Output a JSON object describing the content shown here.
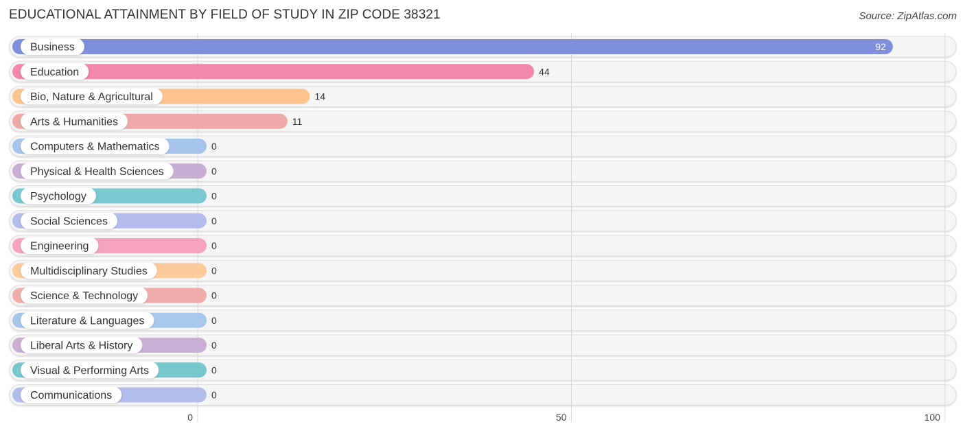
{
  "header": {
    "title": "EDUCATIONAL ATTAINMENT BY FIELD OF STUDY IN ZIP CODE 38321",
    "source": "Source: ZipAtlas.com"
  },
  "chart_data": {
    "type": "bar",
    "orientation": "horizontal",
    "title": "EDUCATIONAL ATTAINMENT BY FIELD OF STUDY IN ZIP CODE 38321",
    "xlabel": "",
    "ylabel": "",
    "xlim": [
      0,
      100
    ],
    "x_ticks": [
      0,
      50,
      100
    ],
    "grid": true,
    "categories": [
      "Business",
      "Education",
      "Bio, Nature & Agricultural",
      "Arts & Humanities",
      "Computers & Mathematics",
      "Physical & Health Sciences",
      "Psychology",
      "Social Sciences",
      "Engineering",
      "Multidisciplinary Studies",
      "Science & Technology",
      "Literature & Languages",
      "Liberal Arts & History",
      "Visual & Performing Arts",
      "Communications"
    ],
    "values": [
      92,
      44,
      14,
      11,
      0,
      0,
      0,
      0,
      0,
      0,
      0,
      0,
      0,
      0,
      0
    ],
    "colors": [
      "#7f8fdc",
      "#f288aa",
      "#fdc48f",
      "#eeaaa7",
      "#a6c5ea",
      "#c9aed3",
      "#77c9cf",
      "#b3bdeb",
      "#f6a3c0",
      "#fdcb9b",
      "#f0aeaa",
      "#a7c7eb",
      "#caaed4",
      "#76c8cd",
      "#b3bdeb"
    ]
  }
}
